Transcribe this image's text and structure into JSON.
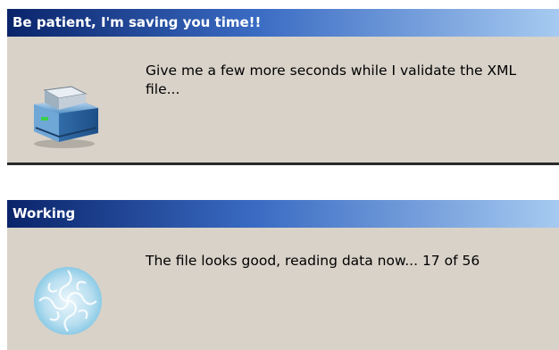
{
  "dialogs": [
    {
      "title": "Be patient, I'm saving you time!!",
      "message": "Give me a few more seconds while I validate the XML file...",
      "icon": "printer-icon"
    },
    {
      "title": "Working",
      "message": "The file looks good, reading data now... 17 of 56",
      "icon": "spinner-icon"
    }
  ],
  "colors": {
    "title_start": "#0a246a",
    "title_end": "#a6caf0",
    "dialog_bg": "#d8d2c9"
  }
}
